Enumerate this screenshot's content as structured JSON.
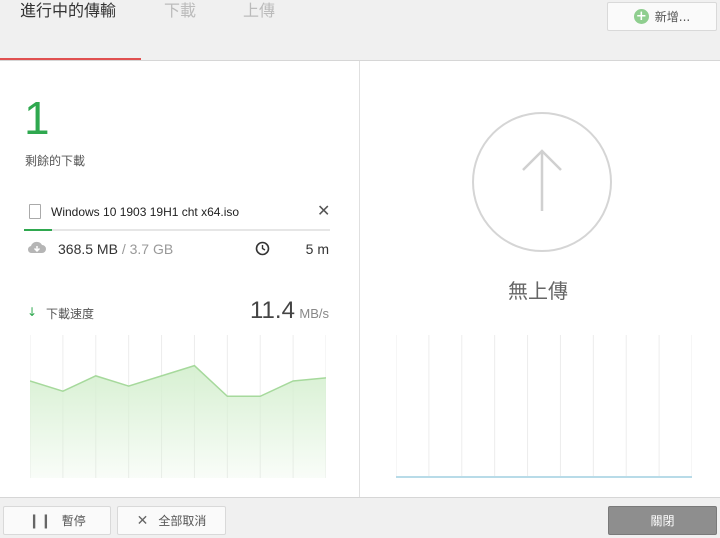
{
  "header": {
    "add_label": "新增...",
    "tabs": [
      {
        "label": "進行中的傳輸",
        "active": true
      },
      {
        "label": "下載",
        "active": false
      },
      {
        "label": "上傳",
        "active": false
      }
    ]
  },
  "downloads": {
    "remaining_count": "1",
    "remaining_label": "剩餘的下載",
    "file": {
      "name": "Windows 10 1903 19H1 cht x64.iso",
      "downloaded": "368.5 MB",
      "separator": " / ",
      "total": "3.7 GB",
      "eta": "5 m",
      "progress": 0.09
    },
    "speed": {
      "label": "下載速度",
      "value": "11.4",
      "unit": "MB/s"
    }
  },
  "uploads": {
    "empty_label": "無上傳"
  },
  "footer": {
    "pause_label": "暫停",
    "cancel_all_label": "全部取消",
    "close_label": "關閉"
  },
  "chart_data": [
    {
      "type": "area",
      "series": [
        {
          "values": [
            9.5,
            8.5,
            10,
            9,
            10,
            11,
            8,
            8,
            9.5,
            9.8
          ]
        }
      ],
      "ylim": [
        0,
        14
      ],
      "grid": true
    },
    {
      "type": "line",
      "series": [
        {
          "values": [
            0,
            0,
            0,
            0,
            0,
            0,
            0,
            0,
            0,
            0
          ]
        }
      ],
      "ylim": [
        0,
        14
      ],
      "grid": true
    }
  ],
  "colors": {
    "accent": "#2fa84f",
    "tab_underline": "#e05050",
    "area_fill": "#d7f0d2",
    "area_stroke": "#a6d99c",
    "upload_line": "#b8dbe8"
  }
}
